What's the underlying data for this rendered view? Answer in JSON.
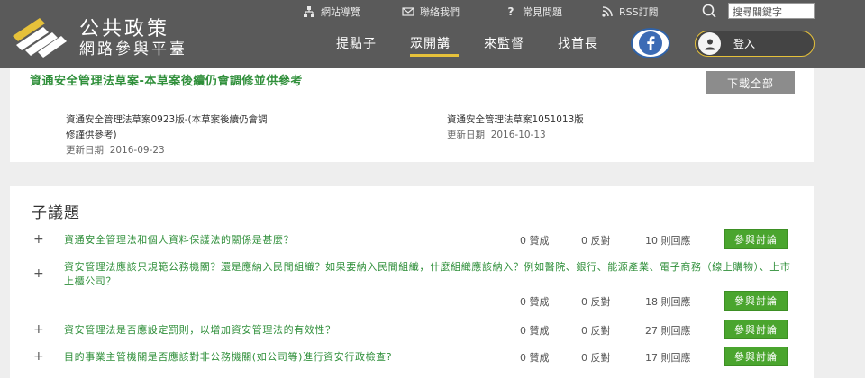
{
  "brand": {
    "line1": "公共政策",
    "line2": "網路參與平臺"
  },
  "utility_nav": [
    {
      "label": "網站導覽",
      "icon": "sitemap-icon"
    },
    {
      "label": "聯絡我們",
      "icon": "mail-icon"
    },
    {
      "label": "常見問題",
      "icon": "question-icon"
    },
    {
      "label": "RSS訂閱",
      "icon": "rss-icon"
    }
  ],
  "search": {
    "value": "搜尋關鍵字"
  },
  "main_nav": [
    {
      "label": "提點子"
    },
    {
      "label": "眾開講",
      "active": true
    },
    {
      "label": "來監督"
    },
    {
      "label": "找首長"
    }
  ],
  "login": {
    "label": "登入"
  },
  "document": {
    "title": "資通安全管理法草案-本草案後續仍會調修並供參考",
    "download_label": "下載全部",
    "versions": [
      {
        "name_line1": "資通安全管理法草案0923版-(本草案後續仍會調",
        "name_line2": "修謹供參考)",
        "date_label": "更新日期",
        "date": "2016-09-23"
      },
      {
        "name_line1": "資通安全管理法草案1051013版",
        "name_line2": "",
        "date_label": "更新日期",
        "date": "2016-10-13"
      }
    ]
  },
  "subtopics": {
    "heading": "子議題",
    "join_label": "參與討論",
    "items": [
      {
        "question": "資通安全管理法和個人資料保護法的關係是甚麼？",
        "agree": "0 贊成",
        "oppose": "0 反對",
        "replies": "10 則回應"
      },
      {
        "question": "資安管理法應該只規範公務機關？還是應納入民間組織？如果要納入民間組織，什麼組織應該納入？例如醫院、銀行、能源產業、電子商務（線上購物）、上市上櫃公司？",
        "agree": "0 贊成",
        "oppose": "0 反對",
        "replies": "18 則回應"
      },
      {
        "question": "資安管理法是否應設定罰則，以增加資安管理法的有效性？",
        "agree": "0 贊成",
        "oppose": "0 反對",
        "replies": "27 則回應"
      },
      {
        "question": "目的事業主管機關是否應該對非公務機關(如公司等)進行資安行政檢查?",
        "agree": "0 贊成",
        "oppose": "0 反對",
        "replies": "17 則回應"
      }
    ]
  },
  "colors": {
    "header_bg": "#5a5a5a",
    "accent_green": "#2f8f3a",
    "button_green": "#4aa52e",
    "accent_gold": "#e6c13a"
  }
}
